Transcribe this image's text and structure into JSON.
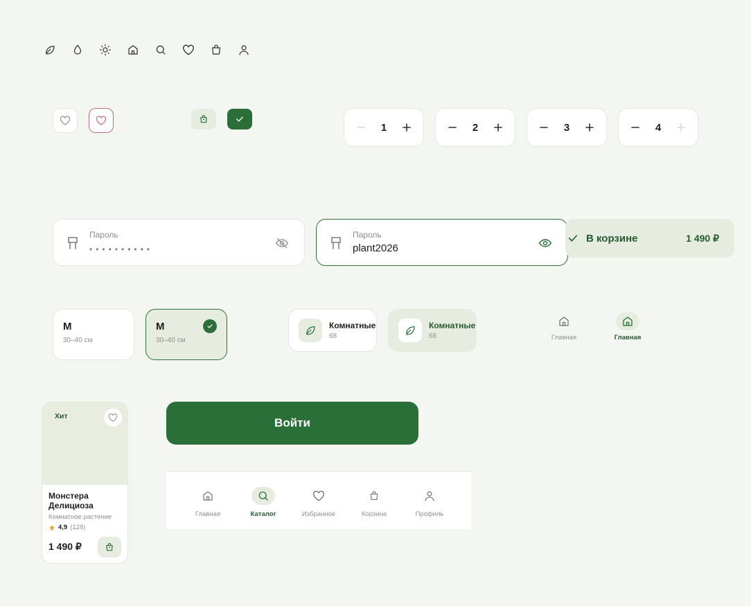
{
  "icons": [
    "leaf-icon",
    "drop-icon",
    "sun-icon",
    "home-icon",
    "search-icon",
    "heart-icon",
    "bag-icon",
    "user-icon"
  ],
  "steppers": [
    {
      "value": "1",
      "minus_disabled": true,
      "plus_disabled": false
    },
    {
      "value": "2",
      "minus_disabled": false,
      "plus_disabled": false
    },
    {
      "value": "3",
      "minus_disabled": false,
      "plus_disabled": false
    },
    {
      "value": "4",
      "minus_disabled": false,
      "plus_disabled": true
    }
  ],
  "password_default": {
    "label": "Пароль",
    "value": "••••••••••"
  },
  "password_focus": {
    "label": "Пароль",
    "value": "plant2026"
  },
  "in_cart": {
    "label": "В корзине",
    "price": "1 490 ₽"
  },
  "sizes": [
    {
      "size": "M",
      "desc": "30–40 см"
    },
    {
      "size": "M",
      "desc": "30–40 см"
    }
  ],
  "categories": [
    {
      "name": "Комнатные",
      "count": "68"
    },
    {
      "name": "Комнатные",
      "count": "68"
    }
  ],
  "nav_mini": [
    {
      "label": "Главная"
    },
    {
      "label": "Главная"
    }
  ],
  "product": {
    "badge": "Хит",
    "name": "Монстера Делициоза",
    "subtitle": "Комнатное растение",
    "rating": "4,9",
    "reviews": "(128)",
    "price": "1 490 ₽"
  },
  "login_button": "Войти",
  "tabbar": [
    {
      "label": "Главная"
    },
    {
      "label": "Каталог"
    },
    {
      "label": "Избранное"
    },
    {
      "label": "Корзина"
    },
    {
      "label": "Профиль"
    }
  ],
  "colors": {
    "accent": "#2a6e38",
    "accent_light": "#e6ede0",
    "bg": "#f4f6f2",
    "fav_active": "#c66b7a",
    "star": "#e8a93a"
  }
}
